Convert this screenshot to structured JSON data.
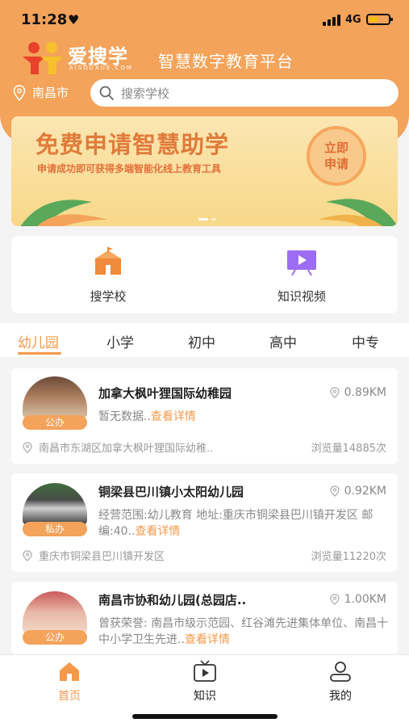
{
  "status_bar": {
    "time": "11:28",
    "network": "4G"
  },
  "header": {
    "brand": "爱搜学",
    "brand_sub": "AISOUXUE.COM",
    "slogan": "智慧数字教育平台",
    "location": "南昌市",
    "search_placeholder": "搜索学校"
  },
  "banner": {
    "title": "免费申请智慧助学",
    "subtitle": "申请成功即可获得多端智能化线上教育工具",
    "button_line1": "立即",
    "button_line2": "申请"
  },
  "quick": [
    {
      "label": "搜学校",
      "icon": "school-icon"
    },
    {
      "label": "知识视频",
      "icon": "video-screen-icon"
    }
  ],
  "tabs": [
    "幼儿园",
    "小学",
    "初中",
    "高中",
    "中专"
  ],
  "active_tab": "幼儿园",
  "schools": [
    {
      "name": "加拿大枫叶狸国际幼稚园",
      "badge": "公办",
      "distance": "0.89KM",
      "desc": "暂无数据..",
      "more": "查看详情",
      "address": "南昌市东湖区加拿大枫叶狸国际幼稚..",
      "views": "浏览量14885次"
    },
    {
      "name": "铜梁县巴川镇小太阳幼儿园",
      "badge": "私办",
      "distance": "0.92KM",
      "desc": "经营范围:幼儿教育 地址:重庆市铜梁县巴川镇开发区 邮编:40..",
      "more": "查看详情",
      "address": "重庆市铜梁县巴川镇开发区",
      "views": "浏览量11220次"
    },
    {
      "name": "南昌市协和幼儿园(总园店..",
      "badge": "公办",
      "distance": "1.00KM",
      "desc": "曾获荣誉: 南昌市级示范园、红谷滩先进集体单位、南昌十中小学卫生先进..",
      "more": "查看详情"
    }
  ],
  "bottom_nav": [
    {
      "label": "首页",
      "icon": "home-icon"
    },
    {
      "label": "知识",
      "icon": "tv-icon"
    },
    {
      "label": "我的",
      "icon": "user-icon"
    }
  ],
  "colors": {
    "accent": "#f39a4a",
    "header": "#f3a35a"
  }
}
